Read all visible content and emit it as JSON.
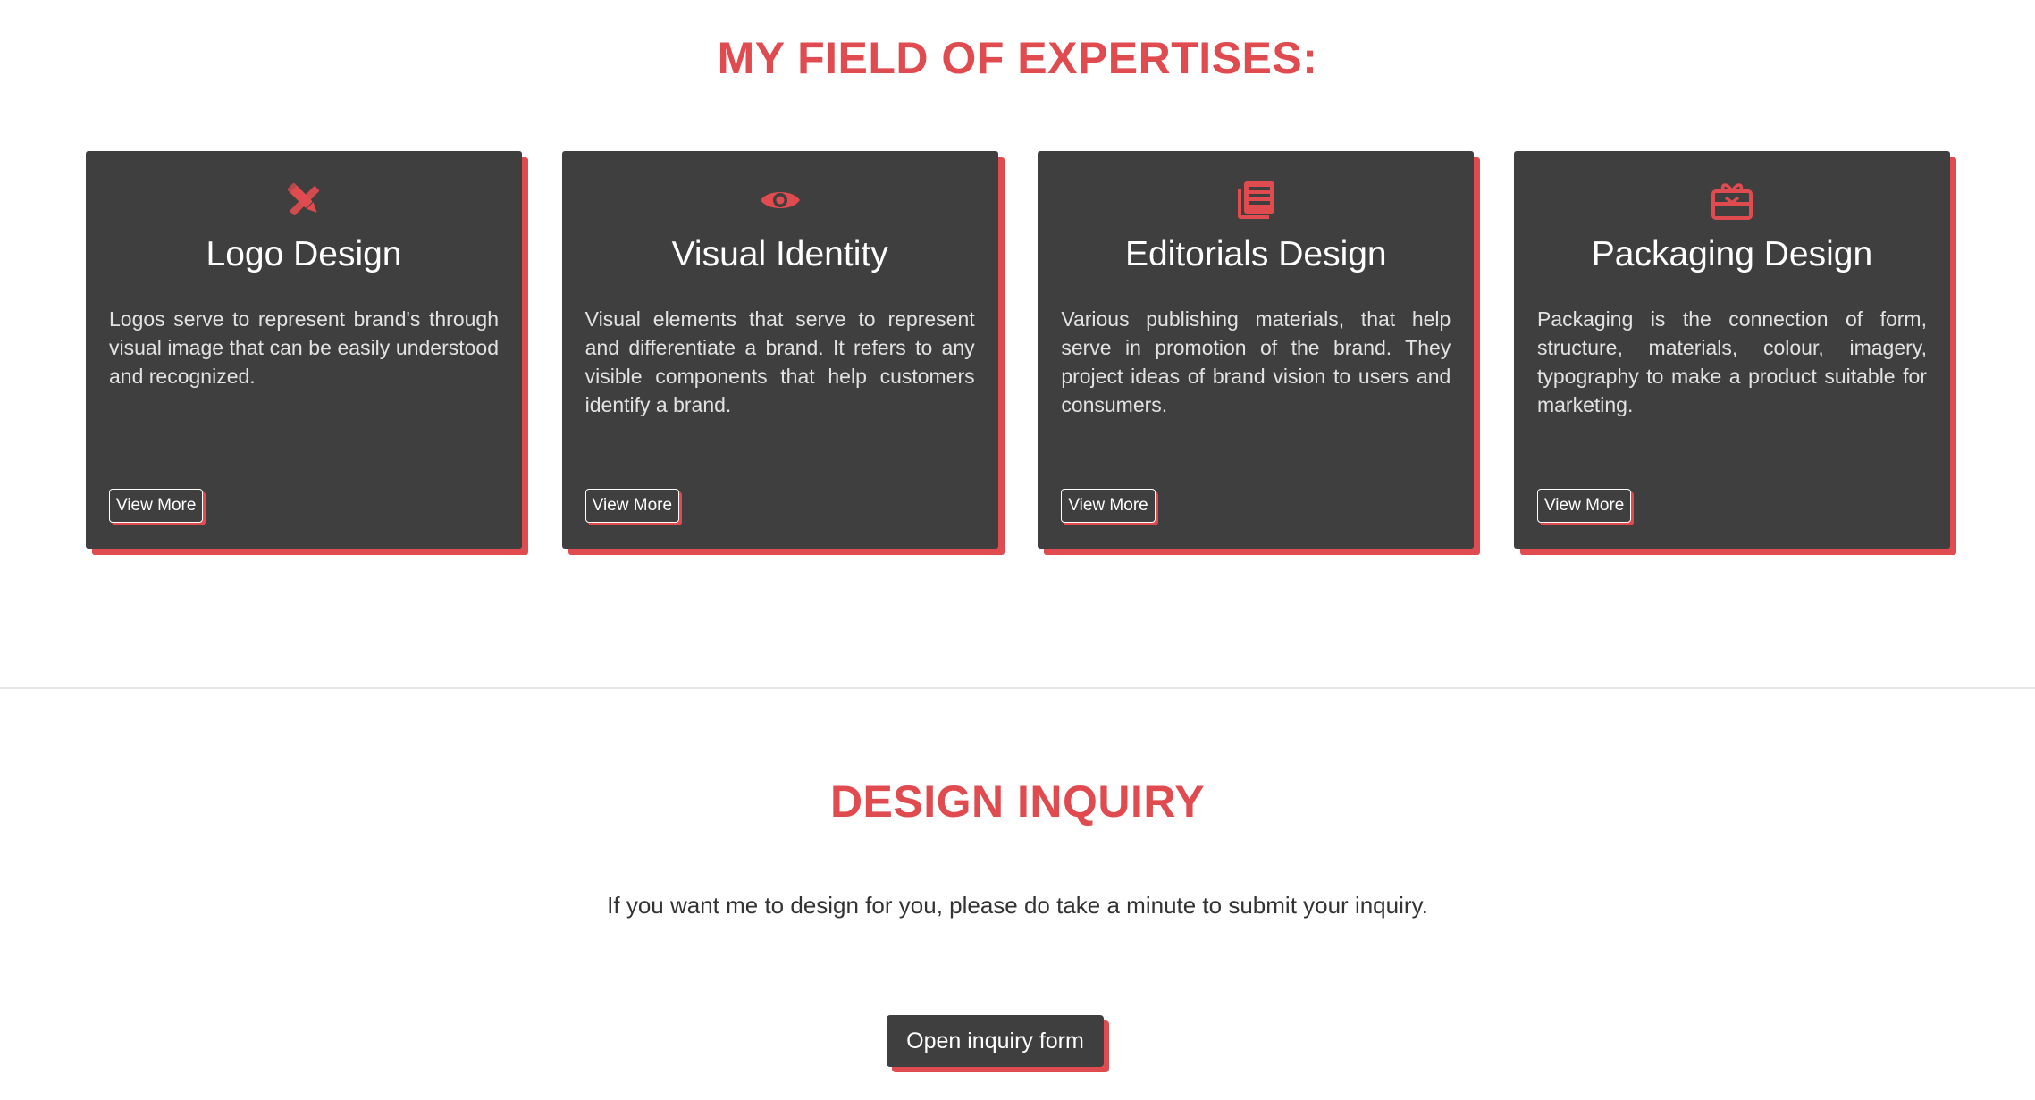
{
  "expertise": {
    "title": "MY FIELD OF EXPERTISES:",
    "cards": [
      {
        "icon": "pencil-ruler-icon",
        "title": "Logo Design",
        "description": "Logos serve to represent brand's through visual image that can be easily understood and recognized.",
        "button_label": "View More"
      },
      {
        "icon": "eye-icon",
        "title": "Visual Identity",
        "description": "Visual elements that serve to represent and differentiate a brand. It refers to any visible components that help customers identify a brand.",
        "button_label": "View More"
      },
      {
        "icon": "newspaper-icon",
        "title": "Editorials Design",
        "description": "Various publishing materials, that help serve in promotion of the brand. They project ideas of brand vision to users and consumers.",
        "button_label": "View More"
      },
      {
        "icon": "gift-box-icon",
        "title": "Packaging Design",
        "description": "Packaging is the connection of form, structure, materials, colour, imagery, typography to make a product suitable for marketing.",
        "button_label": "View More"
      }
    ]
  },
  "inquiry": {
    "title": "DESIGN INQUIRY",
    "text": "If you want me to design for you, please do take a minute to submit your inquiry.",
    "button_label": "Open inquiry form"
  },
  "colors": {
    "accent": "#e04b50",
    "card_background": "#3f3f3f",
    "text_dark": "#333333",
    "background": "#ffffff"
  }
}
